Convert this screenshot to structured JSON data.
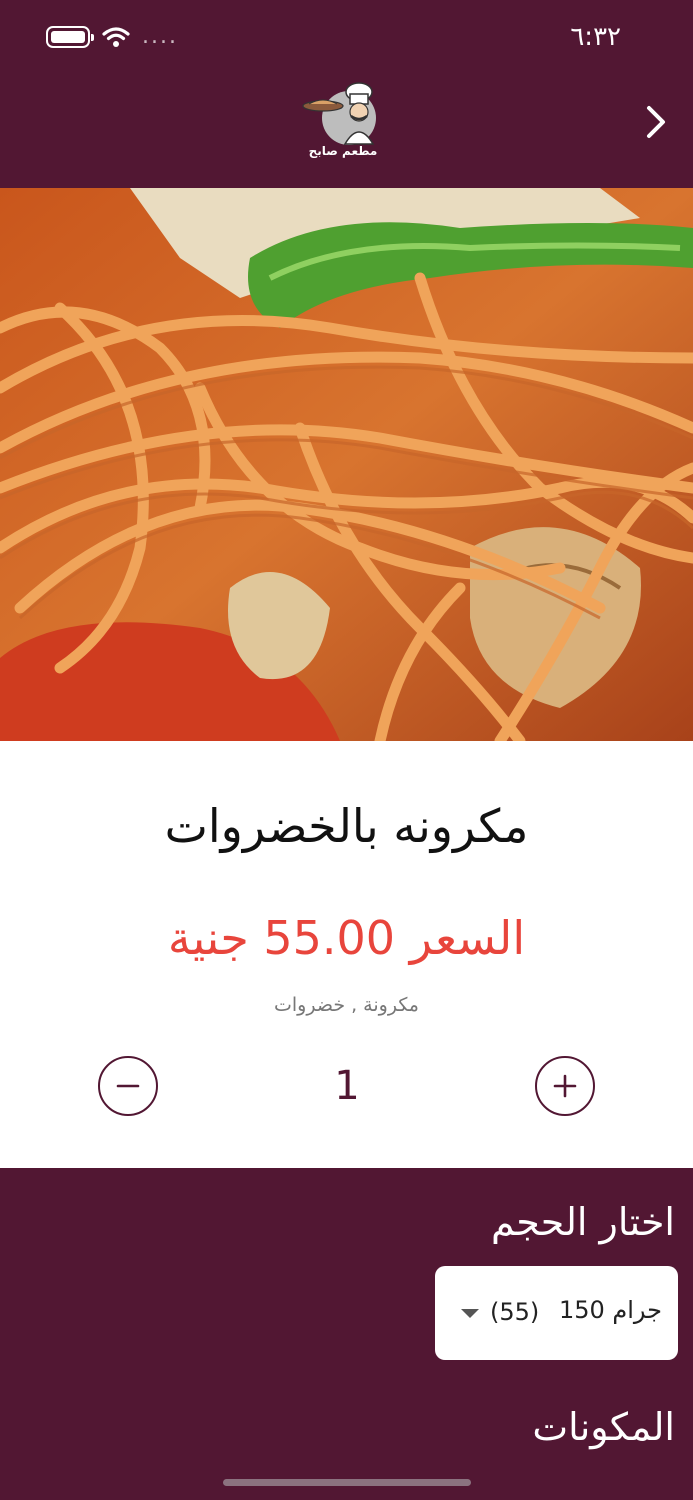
{
  "status_bar": {
    "time": "٦:٣٢",
    "signal": "....",
    "icons": [
      "battery-icon",
      "wifi-icon",
      "signal-icon"
    ]
  },
  "header": {
    "logo_text": "مطعم صابح",
    "back_icon": "chevron-right-icon"
  },
  "hero": {
    "image_subject": "spaghetti with vegetables"
  },
  "item": {
    "name": "مكرونه بالخضروات",
    "price_label": "السعر 55.00 جنية",
    "ingredients": "مكرونة , خضروات",
    "quantity": "1",
    "minus_icon": "minus-icon",
    "plus_icon": "plus-icon"
  },
  "size": {
    "title": "اختار الحجم",
    "selected_label": "150 جرام",
    "selected_price": "(55)",
    "caret_icon": "caret-down-icon"
  },
  "addons": {
    "title": "المكونات"
  },
  "colors": {
    "brand": "#521733",
    "price": "#e8453c",
    "background": "#ffffff"
  }
}
